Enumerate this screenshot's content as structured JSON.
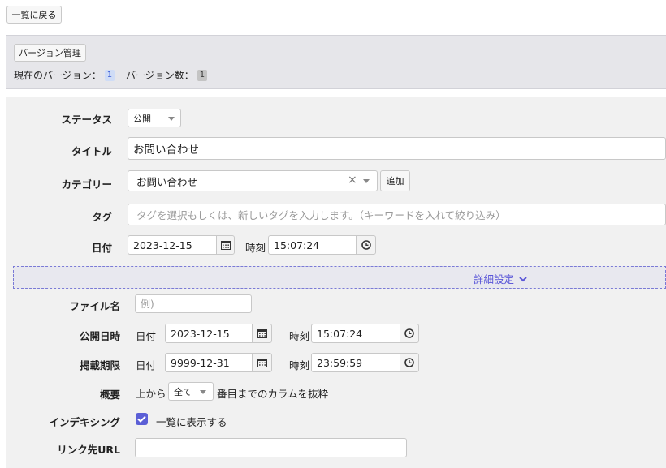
{
  "top": {
    "back_button": "一覧に戻る"
  },
  "version": {
    "manage_button": "バージョン管理",
    "current_label": "現在のバージョン：",
    "current_value": "1",
    "count_label": "バージョン数：",
    "count_value": "1"
  },
  "form": {
    "status": {
      "label": "ステータス",
      "value": "公開"
    },
    "title": {
      "label": "タイトル",
      "value": "お問い合わせ"
    },
    "category": {
      "label": "カテゴリー",
      "value": "お問い合わせ",
      "clear": "×",
      "add_button": "追加"
    },
    "tag": {
      "label": "タグ",
      "placeholder": "タグを選択もしくは、新しいタグを入力します。（キーワードを入れて絞り込み）"
    },
    "date": {
      "label": "日付",
      "date_value": "2023-12-15",
      "time_label": "時刻",
      "time_value": "15:07:24"
    }
  },
  "detail": {
    "toggle_label": "詳細設定",
    "filename": {
      "label": "ファイル名",
      "placeholder": "例)"
    },
    "publish": {
      "label": "公開日時",
      "date_label": "日付",
      "date_value": "2023-12-15",
      "time_label": "時刻",
      "time_value": "15:07:24"
    },
    "expire": {
      "label": "掲載期限",
      "date_label": "日付",
      "date_value": "9999-12-31",
      "time_label": "時刻",
      "time_value": "23:59:59"
    },
    "summary": {
      "label": "概要",
      "prefix": "上から",
      "select_value": "全て",
      "suffix": "番目までのカラムを抜粋"
    },
    "indexing": {
      "label": "インデキシング",
      "checkbox_label": "一覧に表示する",
      "checked": true
    },
    "link_url": {
      "label": "リンク先URL",
      "value": ""
    }
  },
  "colors": {
    "accent": "#5b5fd6",
    "panel": "#f1f1f1",
    "version_panel": "#e6e6ea"
  }
}
